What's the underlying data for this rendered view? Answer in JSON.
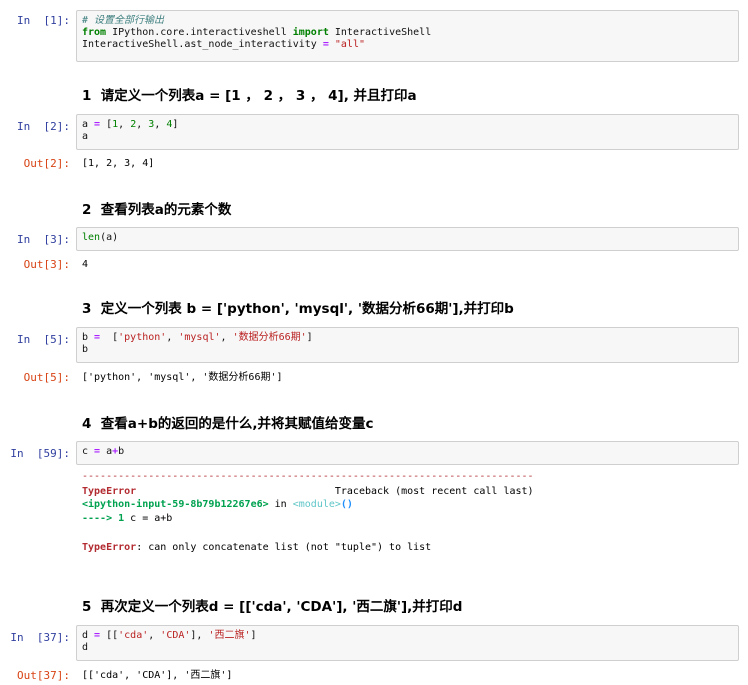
{
  "cells": {
    "c1": {
      "prompt": "In  [1]:",
      "comment": "# 设置全部行输出",
      "from_kw": "from",
      "module": " IPython.core.interactiveshell ",
      "import_kw": "import",
      "cls": " InteractiveShell",
      "line3_a": "InteractiveShell.ast_node_interactivity ",
      "line3_op": "=",
      "line3_b": " ",
      "line3_str": "\"all\""
    },
    "md1": "1  请定义一个列表a = [1 ， 2 ， 3 ， 4], 并且打印a",
    "c2": {
      "prompt": "In  [2]:",
      "line1_a": "a ",
      "line1_op": "=",
      "line1_b": " [",
      "n1": "1",
      "sep1": ", ",
      "n2": "2",
      "sep2": ", ",
      "n3": "3",
      "sep3": ", ",
      "n4": "4",
      "line1_end": "]",
      "line2": "a",
      "out_prompt": "Out[2]:",
      "output": "[1, 2, 3, 4]"
    },
    "md2": "2  查看列表a的元素个数",
    "c3": {
      "prompt": "In  [3]:",
      "builtin": "len",
      "rest": "(a)",
      "out_prompt": "Out[3]:",
      "output": "4"
    },
    "md3": "3  定义一个列表 b = ['python', 'mysql', '数据分析66期'],并打印b",
    "c5": {
      "prompt": "In  [5]:",
      "line1_a": "b ",
      "line1_op": "=",
      "line1_b": "  [",
      "s1": "'python'",
      "sep1": ", ",
      "s2": "'mysql'",
      "sep2": ", ",
      "s3": "'数据分析66期'",
      "line1_end": "]",
      "line2": "b",
      "out_prompt": "Out[5]:",
      "output": "['python', 'mysql', '数据分析66期']"
    },
    "md4": "4  查看a+b的返回的是什么,并将其赋值给变量c",
    "c59": {
      "prompt": "In  [59]:",
      "line1_a": "c ",
      "line1_op": "=",
      "line1_b": " a",
      "line1_op2": "+",
      "line1_c": "b",
      "err_dashes": "---------------------------------------------------------------------------",
      "err_type": "TypeError",
      "err_traceback": "                                 Traceback (most recent call last)",
      "err_input": "<ipython-input-59-8b79b12267e6>",
      "err_in": " in ",
      "err_module": "<module>",
      "err_parens": "()",
      "err_arrow": "----> 1 ",
      "err_code": "c = a+b",
      "err_type2": "TypeError",
      "err_msg": ": can only concatenate list (not \"tuple\") to list"
    },
    "md5": "5  再次定义一个列表d = [['cda', 'CDA'], '西二旗'],并打印d",
    "c37": {
      "prompt": "In  [37]:",
      "line1_a": "d ",
      "line1_op": "=",
      "line1_b": " [[",
      "s1": "'cda'",
      "sep1": ", ",
      "s2": "'CDA'",
      "sep2": "], ",
      "s3": "'西二旗'",
      "line1_end": "]",
      "line2": "d",
      "out_prompt": "Out[37]:",
      "output": "[['cda', 'CDA'], '西二旗']"
    }
  },
  "colors": {
    "prompt_in": "#303f9f",
    "prompt_out": "#d84315",
    "cell_bg": "#f7f7f7",
    "cell_border": "#cfcfcf"
  }
}
